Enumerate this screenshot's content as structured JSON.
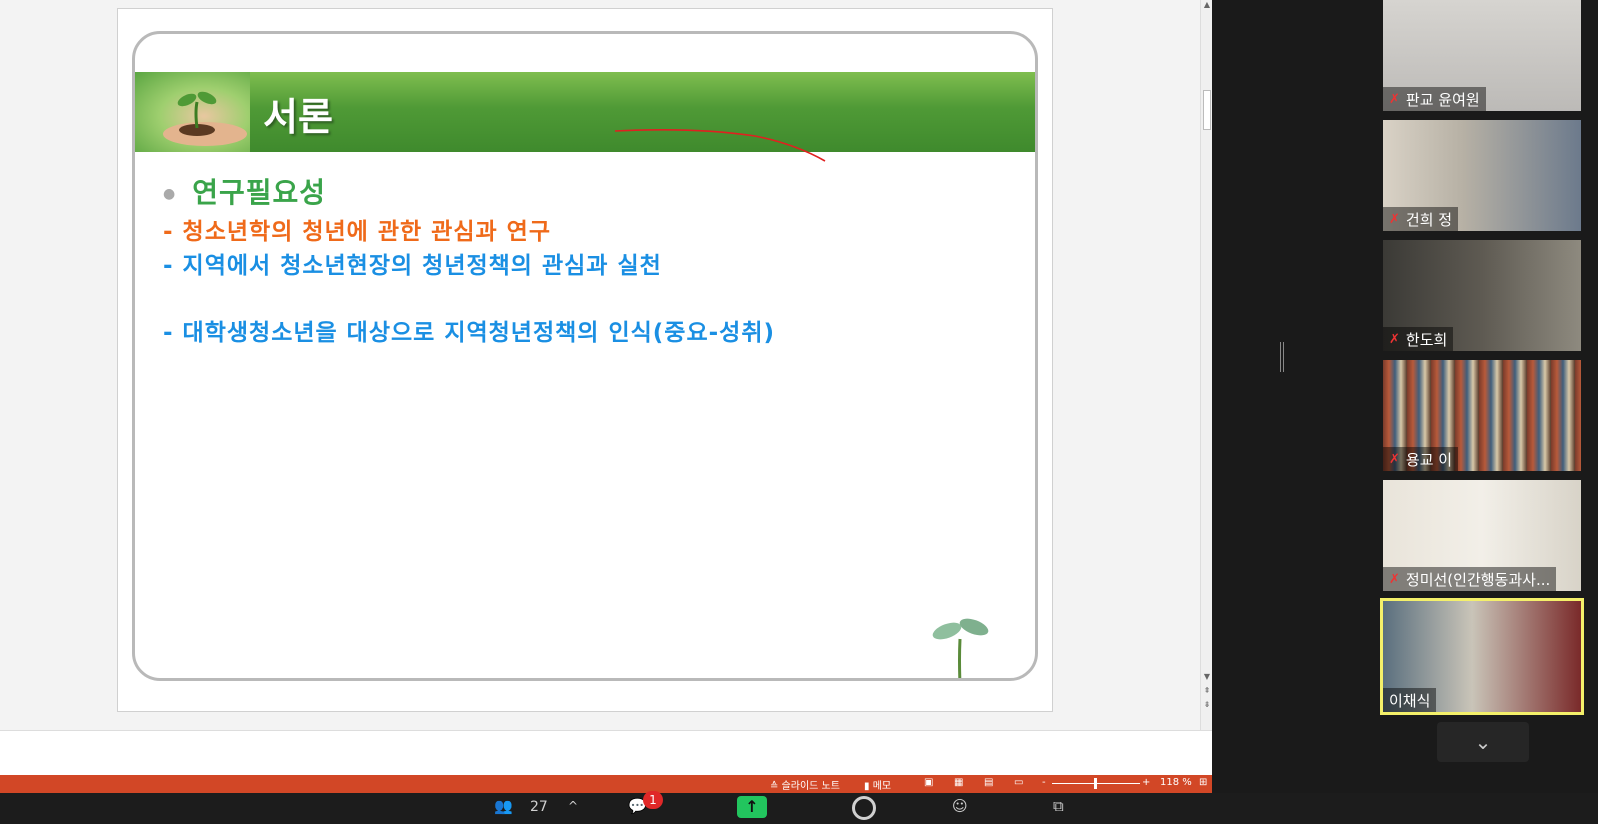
{
  "slide": {
    "title": "서론",
    "bullet_1": "연구필요성",
    "bullet_2": "- 청소년학의 청년에 관한 관심과 연구",
    "bullet_3": "- 지역에서 청소년현장의 청년정책의 관심과 실천",
    "bullet_4": "- 대학생청소년을 대상으로 지역청년정책의 인식(중요-성취)"
  },
  "statusbar": {
    "notes_label": "≙ 슬라이드 노트",
    "comments_label": "메모",
    "zoom_minus": "-",
    "zoom_plus": "+",
    "zoom_level": "118 %"
  },
  "participants_tiles": [
    {
      "name": "판교 윤여원",
      "muted": true
    },
    {
      "name": "건희 정",
      "muted": true
    },
    {
      "name": "한도희",
      "muted": true
    },
    {
      "name": "용교 이",
      "muted": true
    },
    {
      "name": "정미선(인간행동과사...",
      "muted": true
    },
    {
      "name": "이채식",
      "muted": false,
      "active_speaker": true
    }
  ],
  "toolbar": {
    "participants_count": "27",
    "chat_badge": "1"
  },
  "icons": {
    "participants": "people-icon",
    "chat": "chat-bubble-icon",
    "share": "share-screen-icon",
    "record": "record-icon",
    "reactions": "emoji-icon",
    "apps": "apps-icon",
    "mute": "muted-mic-icon"
  },
  "colors": {
    "accent_green": "#3aa44a",
    "accent_orange": "#ef6a1a",
    "accent_blue": "#1a8fe3",
    "statusbar": "#d24726",
    "share_button": "#22c55e",
    "active_speaker_border": "#f4f06a"
  }
}
